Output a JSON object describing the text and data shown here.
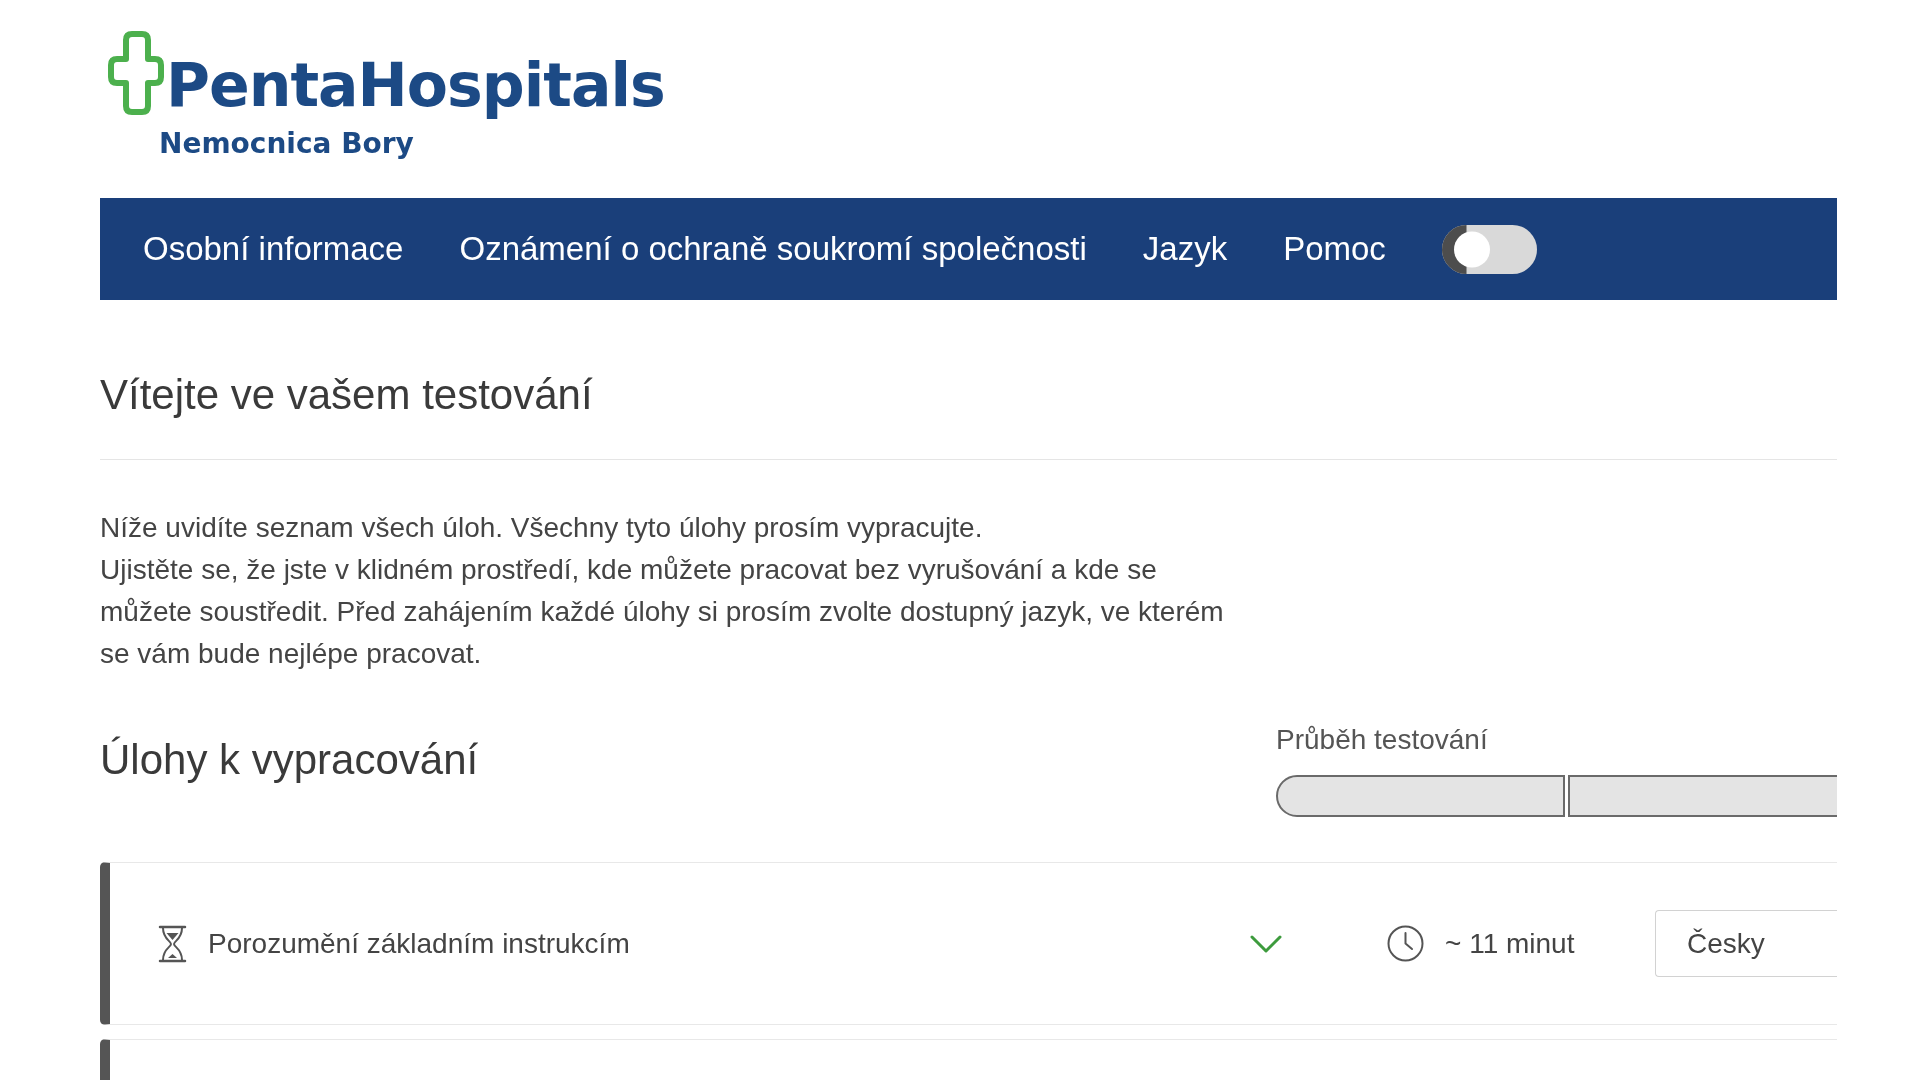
{
  "logo": {
    "name": "PentaHospitals",
    "subtitle": "Nemocnica Bory"
  },
  "nav": {
    "items": [
      "Osobní informace",
      "Oznámení o ochraně soukromí společnosti",
      "Jazyk",
      "Pomoc"
    ],
    "toggle": {
      "on": false
    }
  },
  "welcome": {
    "title": "Vítejte ve vašem testování",
    "paragraphs": [
      "Níže uvidíte seznam všech úloh. Všechny tyto úlohy prosím vypracujte.",
      "Ujistěte se, že jste v klidném prostředí, kde můžete pracovat bez vyrušování a kde se můžete soustředit. Před zahájením každé úlohy si prosím zvolte dostupný jazyk, ve kterém se vám bude nejlépe pracovat."
    ]
  },
  "tasks_section": {
    "title": "Úlohy k vypracování",
    "progress": {
      "label": "Průběh testování",
      "segments": [
        {
          "completed": false
        },
        {
          "completed": false
        }
      ]
    },
    "tasks": [
      {
        "kind": "task",
        "title": "Porozumění základním instrukcím",
        "expanded": false,
        "duration": "~ 11 minut",
        "language": "Česky"
      },
      {
        "kind": "partial"
      }
    ]
  }
}
